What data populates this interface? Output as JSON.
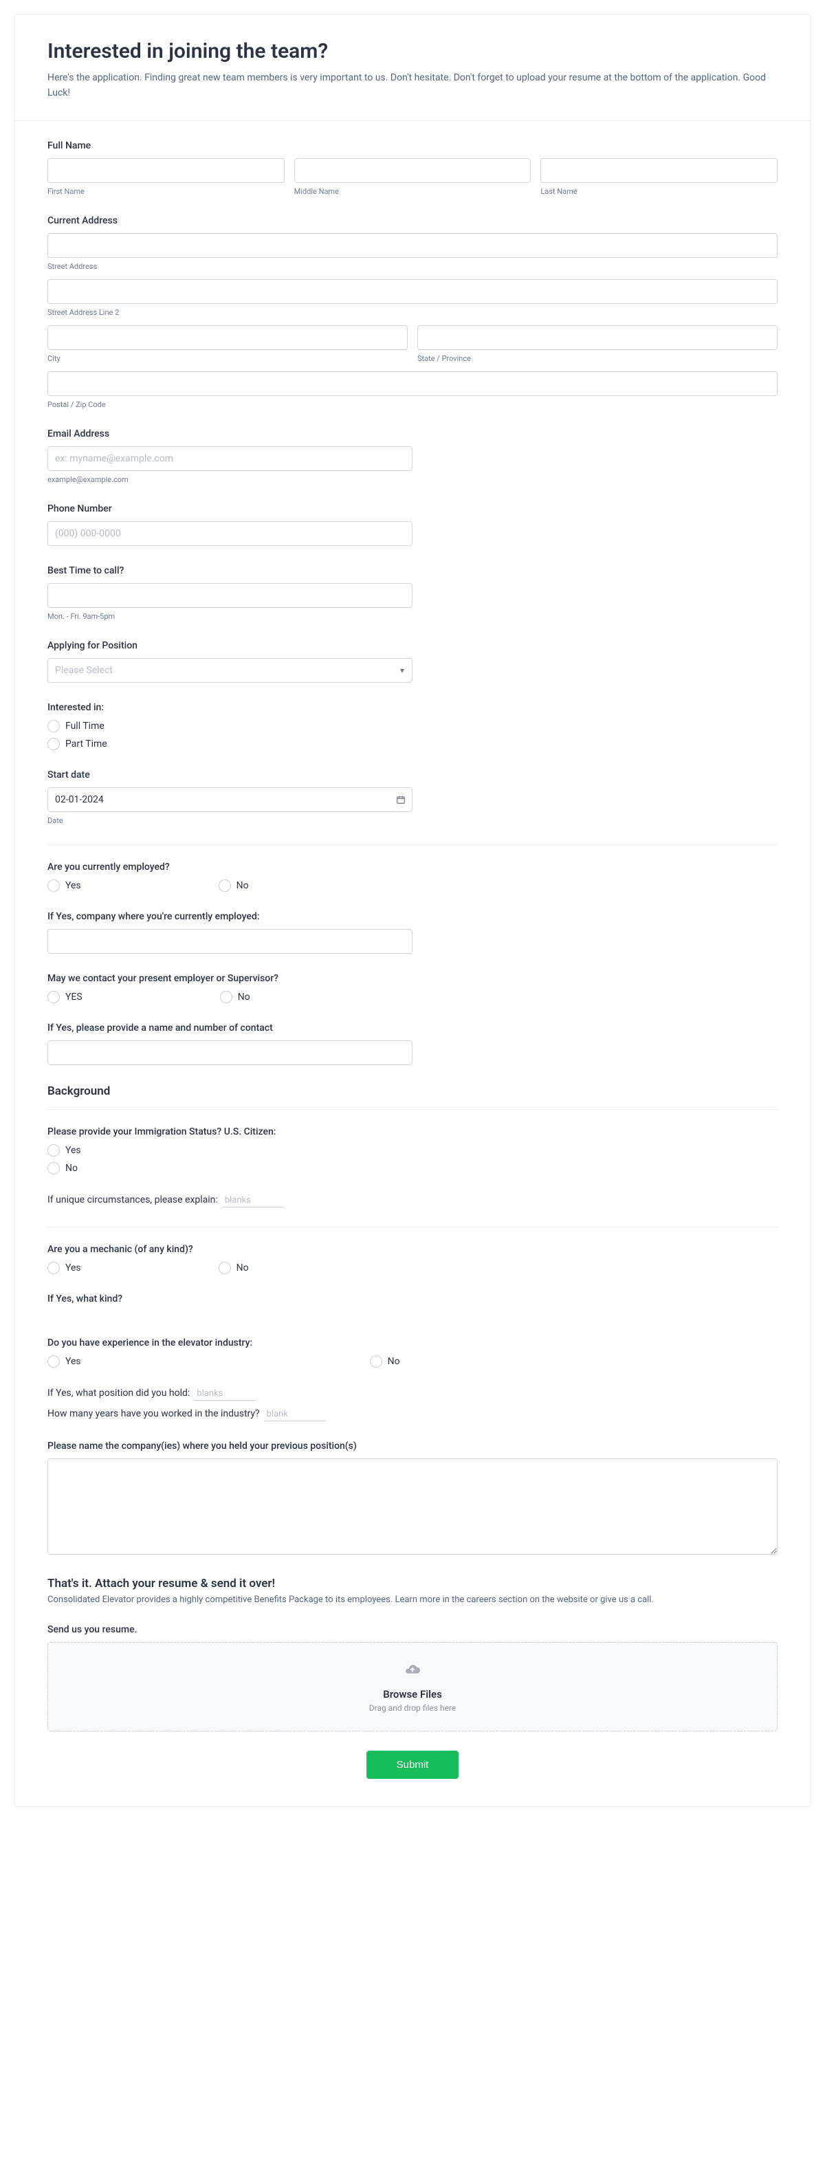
{
  "header": {
    "title": "Interested in joining the team?",
    "subtitle": "Here's the application. Finding great new team members is very important to us. Don't hesitate. Don't forget to upload your resume at the bottom of the application. Good Luck!"
  },
  "fullName": {
    "label": "Full Name",
    "first": "First Name",
    "middle": "Middle Name",
    "last": "Last Name"
  },
  "address": {
    "label": "Current Address",
    "street": "Street Address",
    "street2": "Street Address Line 2",
    "city": "City",
    "state": "State / Province",
    "postal": "Postal / Zip Code"
  },
  "email": {
    "label": "Email Address",
    "placeholder": "ex: myname@example.com",
    "sub": "example@example.com"
  },
  "phone": {
    "label": "Phone Number",
    "placeholder": "(000) 000-0000"
  },
  "bestTime": {
    "label": "Best Time to call?",
    "sub": "Mon. - Fri. 9am-5pm"
  },
  "position": {
    "label": "Applying for Position",
    "placeholder": "Please Select"
  },
  "interested": {
    "label": "Interested in:",
    "opt1": "Full Time",
    "opt2": "Part Time"
  },
  "startDate": {
    "label": "Start date",
    "value": "02-01-2024",
    "sub": "Date"
  },
  "employed": {
    "label": "Are you currently employed?",
    "yes": "Yes",
    "no": "No"
  },
  "company": {
    "label": "If Yes, company where you're currently employed:"
  },
  "contact": {
    "label": "May we contact your present employer or Supervisor?",
    "yes": "YES",
    "no": "No"
  },
  "contactInfo": {
    "label": "If Yes, please provide a name and number of contact"
  },
  "background": {
    "heading": "Background"
  },
  "immigration": {
    "label": "Please provide your Immigration Status? U.S. Citizen:",
    "yes": "Yes",
    "no": "No"
  },
  "unique": {
    "label": "If unique circumstances, please explain:",
    "placeholder": "blanks"
  },
  "mechanic": {
    "label": "Are you a mechanic (of any kind)?",
    "yes": "Yes",
    "no": "No"
  },
  "mechanicKind": {
    "label": "If Yes, what kind?"
  },
  "elevator": {
    "label": "Do you have experience in the elevator industry:",
    "yes": "Yes",
    "no": "No"
  },
  "prevPosition": {
    "label": "If Yes, what position did you hold:",
    "placeholder": "blanks"
  },
  "years": {
    "label": "How many years have you worked in the industry?",
    "placeholder": "blank"
  },
  "companies": {
    "label": "Please name the company(ies) where you held your previous position(s)"
  },
  "resume": {
    "heading": "That's it. Attach your resume & send it over!",
    "sub": "Consolidated Elevator provides a highly competitive Benefits Package to its employees. Learn more in the careers section on the website or give us a call.",
    "label": "Send us you resume.",
    "browse": "Browse Files",
    "dnd": "Drag and drop files here"
  },
  "submit": "Submit"
}
